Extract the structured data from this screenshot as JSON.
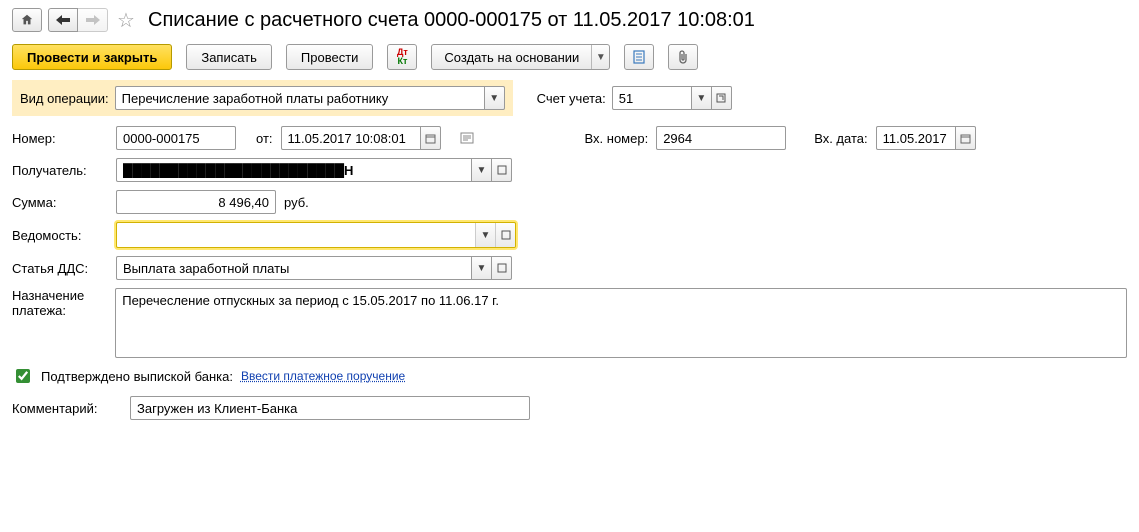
{
  "title": "Списание с расчетного счета 0000-000175 от 11.05.2017 10:08:01",
  "toolbar": {
    "submit_close": "Провести и закрыть",
    "record": "Записать",
    "submit": "Провести",
    "create_based": "Создать на основании"
  },
  "operation": {
    "label": "Вид операции:",
    "value": "Перечисление заработной платы работнику"
  },
  "account": {
    "label": "Счет учета:",
    "value": "51"
  },
  "number": {
    "label": "Номер:",
    "value": "0000-000175",
    "from_label": "от:",
    "datetime": "11.05.2017 10:08:01"
  },
  "incoming": {
    "num_label": "Вх. номер:",
    "num_value": "2964",
    "date_label": "Вх. дата:",
    "date_value": "11.05.2017"
  },
  "recipient": {
    "label": "Получатель:",
    "value": "████████████████████████Н"
  },
  "sum": {
    "label": "Сумма:",
    "value": "8 496,40",
    "unit": "руб."
  },
  "sheet": {
    "label": "Ведомость:",
    "value": ""
  },
  "dds": {
    "label": "Статья ДДС:",
    "value": "Выплата заработной платы"
  },
  "purpose": {
    "label1": "Назначение",
    "label2": "платежа:",
    "value": "Перечесление отпускных за период с 15.05.2017 по 11.06.17 г."
  },
  "confirm": {
    "label": "Подтверждено выпиской банка:",
    "link": "Ввести платежное поручение"
  },
  "comment": {
    "label": "Комментарий:",
    "value": "Загружен из Клиент-Банка"
  }
}
